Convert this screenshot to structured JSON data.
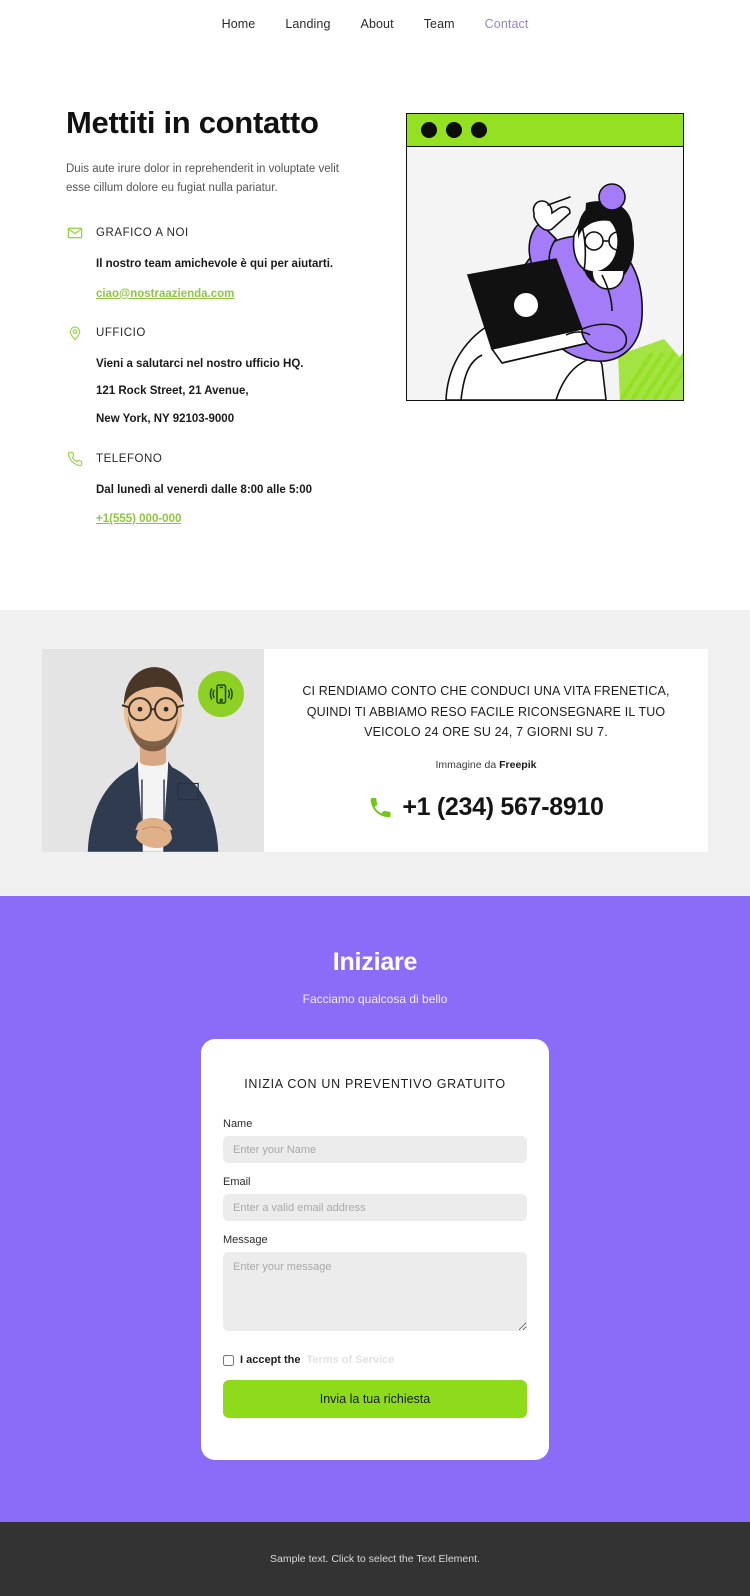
{
  "nav": {
    "items": [
      {
        "label": "Home",
        "active": false
      },
      {
        "label": "Landing",
        "active": false
      },
      {
        "label": "About",
        "active": false
      },
      {
        "label": "Team",
        "active": false
      },
      {
        "label": "Contact",
        "active": true
      }
    ]
  },
  "hero": {
    "title": "Mettiti in contatto",
    "subtitle": "Duis aute irure dolor in reprehenderit in voluptate velit esse cillum dolore eu fugiat nulla pariatur.",
    "blocks": [
      {
        "icon": "envelope-icon",
        "label": "GRAFICO A NOI",
        "line1": "Il nostro team amichevole è qui per aiutarti.",
        "link": "ciao@nostraazienda.com"
      },
      {
        "icon": "map-pin-icon",
        "label": "UFFICIO",
        "line1": "Vieni a salutarci nel nostro ufficio HQ.",
        "line2": "121 Rock Street, 21 Avenue,",
        "line3": "New York, NY 92103-9000"
      },
      {
        "icon": "phone-icon",
        "label": "TELEFONO",
        "line1": "Dal lunedì al venerdì dalle 8:00 alle 5:00",
        "link": "+1(555) 000-000"
      }
    ],
    "illustration": {
      "alt": "woman-with-laptop-illustration",
      "dot_count": 3,
      "bar_color": "#94e023"
    }
  },
  "banner": {
    "photo_alt": "man-in-glasses-photo",
    "badge_icon": "vibrating-phone-icon",
    "headline": "CI RENDIAMO CONTO CHE CONDUCI UNA VITA FRENETICA, QUINDI TI ABBIAMO RESO FACILE RICONSEGNARE IL TUO VEICOLO 24 ORE SU 24, 7 GIORNI SU 7.",
    "credit_prefix": "Immagine da ",
    "credit_source": "Freepik",
    "phone": "+1 (234) 567-8910",
    "phone_icon": "phone-handset-icon"
  },
  "form_section": {
    "title": "Iniziare",
    "subtitle": "Facciamo qualcosa di bello",
    "card_title": "INIZIA CON UN PREVENTIVO GRATUITO",
    "fields": {
      "name_label": "Name",
      "name_placeholder": "Enter your Name",
      "name_value": "",
      "email_label": "Email",
      "email_placeholder": "Enter a valid email address",
      "email_value": "",
      "message_label": "Message",
      "message_placeholder": "Enter your message",
      "message_value": ""
    },
    "terms_prefix": "I accept the ",
    "terms_link": "Terms of Service",
    "terms_checked": false,
    "submit_label": "Invia la tua richiesta"
  },
  "footer": {
    "text": "Sample text. Click to select the Text Element."
  },
  "colors": {
    "purple": "#8b6cf8",
    "green": "#8ddb1b",
    "light_green": "#9bd34f",
    "grey_section": "#f0f0f0",
    "footer": "#333333"
  }
}
